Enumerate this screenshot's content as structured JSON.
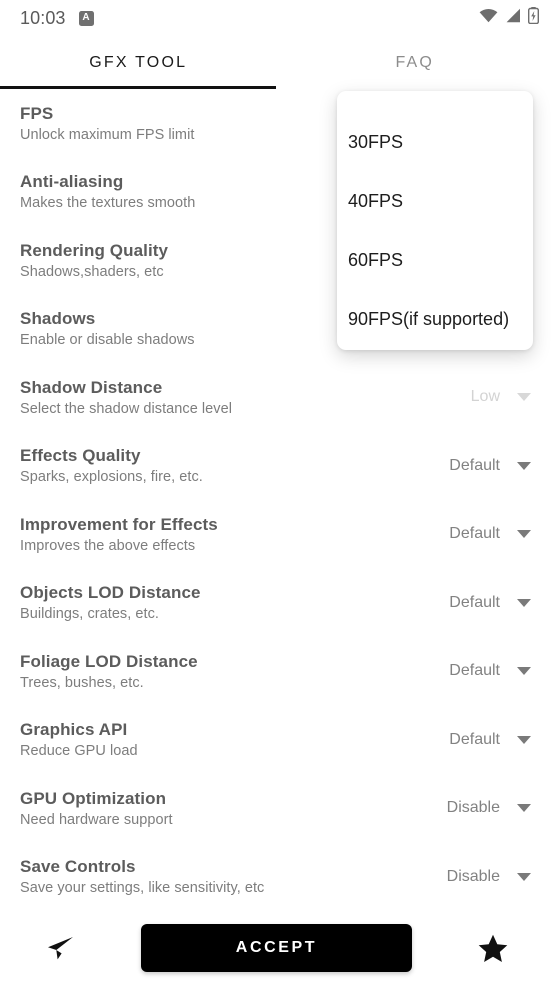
{
  "status_bar": {
    "time": "10:03",
    "notification_badge": "A",
    "icons": [
      "wifi-icon",
      "cellular-signal-icon",
      "battery-charging-icon"
    ]
  },
  "tabs": [
    {
      "label": "GFX TOOL",
      "active": true
    },
    {
      "label": "FAQ",
      "active": false
    }
  ],
  "settings": [
    {
      "title": "FPS",
      "subtitle": "Unlock maximum FPS limit",
      "value": "",
      "dimmed": true
    },
    {
      "title": "Anti-aliasing",
      "subtitle": "Makes the textures smooth",
      "value": "",
      "dimmed": true
    },
    {
      "title": "Rendering Quality",
      "subtitle": "Shadows,shaders, etc",
      "value": "",
      "dimmed": true
    },
    {
      "title": "Shadows",
      "subtitle": "Enable or disable shadows",
      "value": "",
      "dimmed": true
    },
    {
      "title": "Shadow Distance",
      "subtitle": "Select the shadow distance level",
      "value": "Low",
      "dimmed": true
    },
    {
      "title": "Effects Quality",
      "subtitle": "Sparks, explosions, fire, etc.",
      "value": "Default",
      "dimmed": false
    },
    {
      "title": "Improvement for Effects",
      "subtitle": "Improves the above effects",
      "value": "Default",
      "dimmed": false
    },
    {
      "title": "Objects LOD Distance",
      "subtitle": "Buildings, crates, etc.",
      "value": "Default",
      "dimmed": false
    },
    {
      "title": "Foliage LOD Distance",
      "subtitle": "Trees, bushes, etc.",
      "value": "Default",
      "dimmed": false
    },
    {
      "title": "Graphics API",
      "subtitle": "Reduce GPU load",
      "value": "Default",
      "dimmed": false
    },
    {
      "title": "GPU Optimization",
      "subtitle": "Need hardware support",
      "value": "Disable",
      "dimmed": false
    },
    {
      "title": "Save Controls",
      "subtitle": "Save your settings, like sensitivity, etc",
      "value": "Disable",
      "dimmed": false
    }
  ],
  "dropdown": {
    "open": true,
    "owner": "FPS",
    "options": [
      "30FPS",
      "40FPS",
      "60FPS",
      "90FPS(if supported)"
    ]
  },
  "bottom_bar": {
    "share_icon": "send-plane-icon",
    "accept_label": "ACCEPT",
    "favorite_icon": "star-icon"
  },
  "colors": {
    "accent": "#000000",
    "title_text": "#5c5c5c",
    "subtitle_text": "#7d7d7d",
    "value_text": "#828282",
    "tab_active": "#1a1a1a",
    "tab_inactive": "#8c8c8c",
    "surface": "#ffffff"
  }
}
